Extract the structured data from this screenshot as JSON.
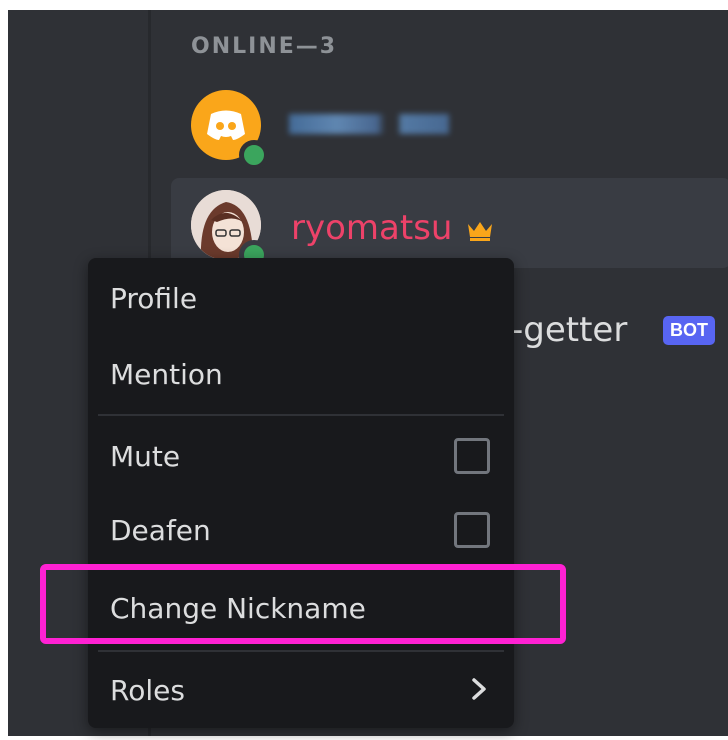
{
  "member_list": {
    "section_header": "ONLINE—3",
    "members": [
      {
        "name": "",
        "avatar": "discord-logo-icon",
        "status": "online",
        "name_redacted": true
      },
      {
        "name": "ryomatsu",
        "avatar": "user-photo",
        "status": "online",
        "badge": "crown-icon",
        "name_color": "#ed4269"
      },
      {
        "name_partial": "-getter",
        "tag": "BOT"
      }
    ]
  },
  "context_menu": {
    "items": [
      {
        "label": "Profile"
      },
      {
        "label": "Mention"
      },
      {
        "label": "Mute",
        "checkbox": false
      },
      {
        "label": "Deafen",
        "checkbox": false
      },
      {
        "label": "Change Nickname",
        "highlighted": true
      },
      {
        "label": "Roles",
        "submenu": true
      }
    ]
  },
  "colors": {
    "background": "#2f3136",
    "menu_background": "#18191c",
    "online": "#3ba55d",
    "discord_avatar": "#faa61a",
    "bot_tag": "#5865f2",
    "highlight_annotation": "#ff21d3"
  }
}
